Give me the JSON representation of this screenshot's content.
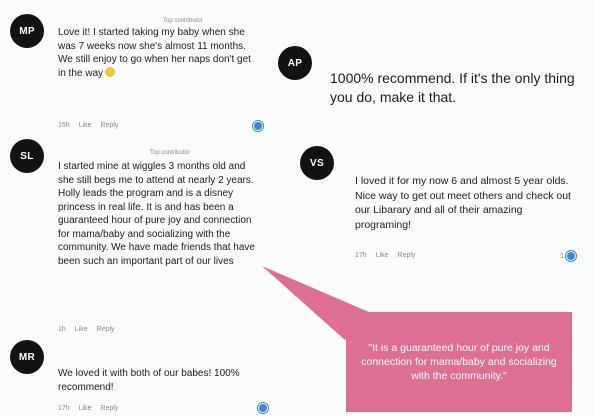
{
  "comments": [
    {
      "initials": "MP",
      "badge": "Top contributor",
      "text": "Love it! I started taking my baby when she was 7 weeks now she's almost 11 months. We still enjoy to go when her naps don't get in the way",
      "time": "15h",
      "like": "Like",
      "reply": "Reply"
    },
    {
      "initials": "SL",
      "badge": "Top contributor",
      "text": "I started mine at wiggles 3 months old and she still begs me to attend at nearly 2 years. Holly leads the program and is a disney princess in real life. It is and has been a guaranteed hour of pure joy and connection for mama/baby and socializing with the community. We have made friends that have been such an important part of our lives",
      "time": "1h",
      "like": "Like",
      "reply": "Reply"
    },
    {
      "initials": "MR",
      "text": "We loved it with both of our babes! 100% recommend!",
      "time": "17h",
      "like": "Like",
      "reply": "Reply"
    },
    {
      "initials": "AP",
      "text": "1000% recommend. If it's the only thing you do, make it that."
    },
    {
      "initials": "VS",
      "text": "I loved it for my now 6 and almost 5 year olds. Nice way to get out meet others and check out our Libarary and all of their amazing programing!",
      "time": "17h",
      "like": "Like",
      "reply": "Reply",
      "reaction_count": "1"
    }
  ],
  "highlight_quote": "\"It is a guaranteed hour of pure joy and connection for mama/baby and socializing with the community.\"",
  "colors": {
    "avatar": "#121212",
    "reaction": "#3a86d8",
    "quote_bg": "#de6f93"
  }
}
